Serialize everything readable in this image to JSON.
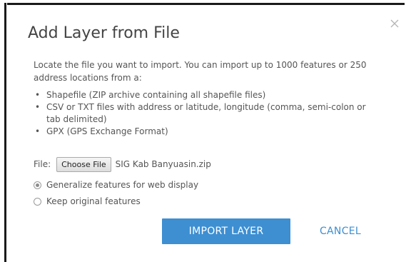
{
  "dialog": {
    "title": "Add Layer from File",
    "intro": "Locate the file you want to import. You can import up to 1000 features or 250 address locations from a:",
    "formats": [
      "Shapefile (ZIP archive containing all shapefile files)",
      "CSV or TXT files with address or latitude, longitude (comma, semi-colon or tab delimited)",
      "GPX (GPS Exchange Format)"
    ],
    "bullet": "•",
    "file": {
      "label": "File:",
      "choose_button": "Choose File",
      "selected_name": "SIG Kab Banyuasin.zip"
    },
    "options": [
      {
        "label": "Generalize features for web display",
        "checked": true
      },
      {
        "label": "Keep original features",
        "checked": false
      }
    ],
    "buttons": {
      "import": "IMPORT LAYER",
      "cancel": "CANCEL"
    },
    "colors": {
      "accent": "#3d8fd2",
      "text": "#555555",
      "close_icon": "#b5b5b5"
    },
    "icons": {
      "close": "close-icon"
    }
  }
}
